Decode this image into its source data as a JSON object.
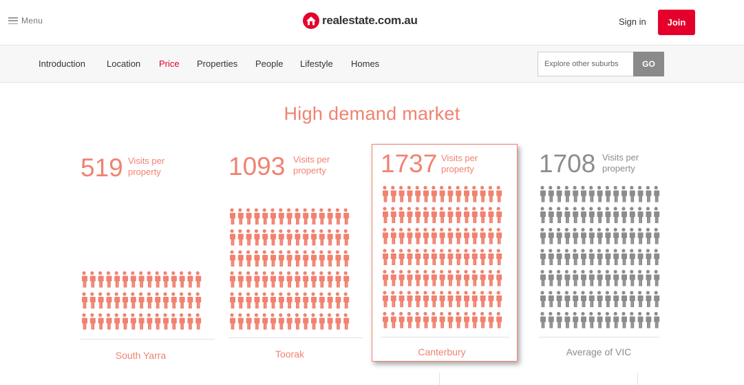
{
  "header": {
    "menu_label": "Menu",
    "logo_text": "realestate.com.au",
    "signin_label": "Sign in",
    "join_label": "Join"
  },
  "subnav": {
    "tabs": [
      {
        "label": "Introduction",
        "active": false
      },
      {
        "label": "Location",
        "active": false
      },
      {
        "label": "Price",
        "active": true
      },
      {
        "label": "Properties",
        "active": false
      },
      {
        "label": "People",
        "active": false
      },
      {
        "label": "Lifestyle",
        "active": false
      },
      {
        "label": "Homes",
        "active": false
      }
    ],
    "search_placeholder": "Explore other suburbs",
    "go_label": "GO"
  },
  "main": {
    "title": "High demand market",
    "metric_label": "Visits per property"
  },
  "chart_data": {
    "type": "bar",
    "title": "High demand market",
    "categories": [
      "South Yarra",
      "Toorak",
      "Canterbury",
      "Average of VIC"
    ],
    "values": [
      519,
      1093,
      1737,
      1708
    ],
    "unit_label": "Visits per property",
    "highlighted": "Canterbury",
    "colors": {
      "accent": "#f08270",
      "average": "#8c8c8c",
      "brand": "#e4002b"
    }
  }
}
